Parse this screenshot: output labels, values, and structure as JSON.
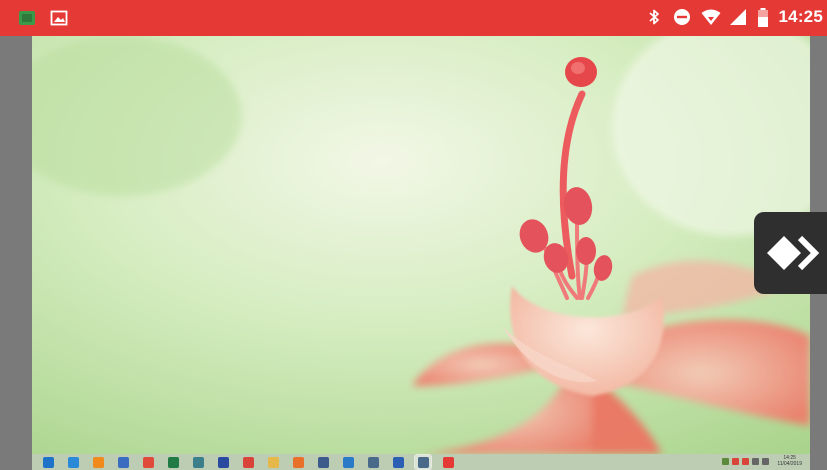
{
  "status_bar": {
    "background": "#e53935",
    "left_icons": [
      "notification-app-icon",
      "image-notification-icon"
    ],
    "right_icons": [
      "bluetooth-icon",
      "do-not-disturb-icon",
      "wifi-icon",
      "signal-icon",
      "battery-icon"
    ],
    "time": "14:25"
  },
  "remote_desktop": {
    "wallpaper": "pink-flower-on-green",
    "taskbar": {
      "apps": [
        {
          "name": "start-button",
          "color": "#1e73c8"
        },
        {
          "name": "internet-explorer-icon",
          "color": "#2a8ad8"
        },
        {
          "name": "vlc-icon",
          "color": "#f08a1c"
        },
        {
          "name": "app-icon-blue",
          "color": "#3a6cc0"
        },
        {
          "name": "chrome-icon",
          "color": "#e04a3a"
        },
        {
          "name": "excel-icon",
          "color": "#1f7a43"
        },
        {
          "name": "app-icon-teal",
          "color": "#3a7f8a"
        },
        {
          "name": "app-icon-navy",
          "color": "#2a4aa0"
        },
        {
          "name": "app-icon-red",
          "color": "#d9443a"
        },
        {
          "name": "file-explorer-icon",
          "color": "#e6b84a"
        },
        {
          "name": "firefox-icon",
          "color": "#e8702a"
        },
        {
          "name": "app-icon-grey",
          "color": "#3c5a8a"
        },
        {
          "name": "app-icon-globe",
          "color": "#2a7ac8"
        },
        {
          "name": "tool-icon",
          "color": "#4a6a8a"
        },
        {
          "name": "word-icon",
          "color": "#2b5fb3"
        },
        {
          "name": "tool-icon-2",
          "color": "#4a6a8a"
        },
        {
          "name": "remote-app-icon",
          "color": "#e53935"
        }
      ],
      "active_app_index": 15,
      "tray_icons": [
        {
          "name": "tray-icon-1",
          "color": "#5a8a3a"
        },
        {
          "name": "tray-icon-2",
          "color": "#d9443a"
        },
        {
          "name": "tray-icon-3",
          "color": "#d9443a"
        },
        {
          "name": "tray-network-icon",
          "color": "#666666"
        },
        {
          "name": "tray-volume-icon",
          "color": "#666666"
        }
      ],
      "clock_time": "14:25",
      "clock_date": "11/04/2019"
    }
  },
  "side_handle": {
    "icon": "anydesk-icon",
    "background": "#2f2f2f"
  }
}
